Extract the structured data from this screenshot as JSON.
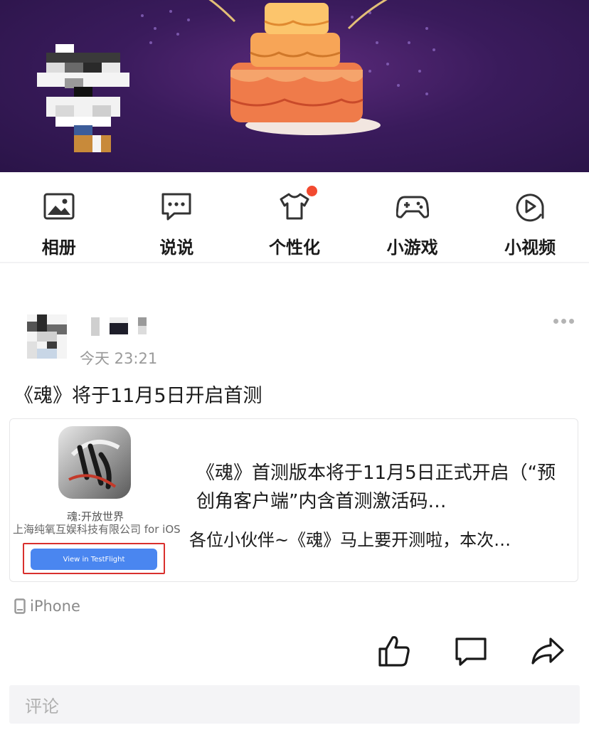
{
  "nav": {
    "items": [
      {
        "label": "相册",
        "icon": "photo-album-icon"
      },
      {
        "label": "说说",
        "icon": "chat-bubble-icon"
      },
      {
        "label": "个性化",
        "icon": "tshirt-icon"
      },
      {
        "label": "小游戏",
        "icon": "gamepad-icon"
      },
      {
        "label": "小视频",
        "icon": "video-play-icon"
      }
    ],
    "badge_color": "#f24a30"
  },
  "post": {
    "time": "今天 23:21",
    "text": "《魂》将于11月5日开启首测",
    "card": {
      "app_name": "魂:开放世界",
      "app_company": "上海纯氧互娱科技有限公司 for iOS",
      "button_label": "View in TestFlight",
      "title": "《魂》首测版本将于11月5日正式开启（“预创角客户端”内含首测激活码…",
      "description": "各位小伙伴~《魂》马上要开测啦，本次…"
    },
    "device": "iPhone",
    "comment_placeholder": "评论"
  },
  "colors": {
    "banner_purple": "#3a1b5c",
    "button_blue": "#4a86f0",
    "highlight_red": "#d9302d"
  }
}
